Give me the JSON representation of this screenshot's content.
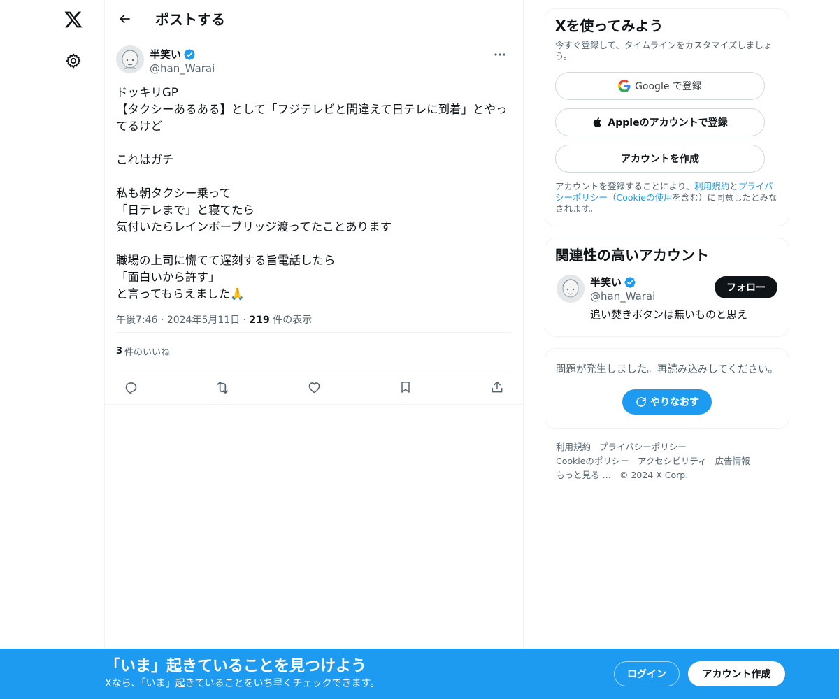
{
  "header": {
    "title": "ポストする"
  },
  "tweet": {
    "author_name": "半笑い",
    "author_handle": "@han_Warai",
    "text": "ドッキリGP\n【タクシーあるある】として「フジテレビと間違えて日テレに到着」とやってるけど\n\nこれはガチ\n\n私も朝タクシー乗って\n「日テレまで」と寝てたら\n気付いたらレインボーブリッジ渡ってたことあります\n\n職場の上司に慌てて遅刻する旨電話したら\n「面白いから許す」\nと言ってもらえました🙏",
    "time": "午後7:46",
    "date": "2024年5月11日",
    "separator": "·",
    "views_count": "219",
    "views_label": " 件の表示",
    "likes_count": "3",
    "likes_label": "件のいいね"
  },
  "signup_card": {
    "title": "Xを使ってみよう",
    "subtitle": "今すぐ登録して、タイムラインをカスタマイズしましょう。",
    "google_label": "Google で登録",
    "apple_label": "Appleのアカウントで登録",
    "create_label": "アカウントを作成",
    "legal_prefix": "アカウントを登録することにより、",
    "legal_terms": "利用規約",
    "legal_and": "と",
    "legal_privacy": "プライバシーポリシー",
    "legal_open": "（",
    "legal_cookie": "Cookieの使用",
    "legal_suffix": "を含む）に同意したとみなされます。"
  },
  "related_card": {
    "title": "関連性の高いアカウント",
    "name": "半笑い",
    "handle": "@han_Warai",
    "bio": "追い焚きボタンは無いものと思え",
    "follow_label": "フォロー"
  },
  "error_card": {
    "text": "問題が発生しました。再読み込みしてください。",
    "retry_label": "やりなおす"
  },
  "footer": {
    "terms": "利用規約",
    "privacy": "プライバシーポリシー",
    "cookie": "Cookieのポリシー",
    "accessibility": "アクセシビリティ",
    "ads": "広告情報",
    "more": "もっと見る …",
    "copyright": "© 2024 X Corp."
  },
  "bottom_bar": {
    "title": "「いま」起きていることを見つけよう",
    "subtitle": "Xなら、「いま」起きていることをいち早くチェックできます。",
    "login_label": "ログイン",
    "signup_label": "アカウント作成"
  },
  "colors": {
    "accent": "#1d9bf0",
    "text_primary": "#0f1419",
    "text_secondary": "#536471",
    "border": "#eff3f4"
  },
  "icons": {
    "logo": "x-logo-icon",
    "settings": "gear-icon",
    "back": "arrow-left-icon",
    "more": "more-dots-icon",
    "verified": "verified-badge-icon",
    "reply": "reply-icon",
    "repost": "repost-icon",
    "like": "heart-icon",
    "bookmark": "bookmark-icon",
    "share": "share-icon",
    "google": "google-icon",
    "apple": "apple-icon",
    "refresh": "refresh-icon"
  }
}
